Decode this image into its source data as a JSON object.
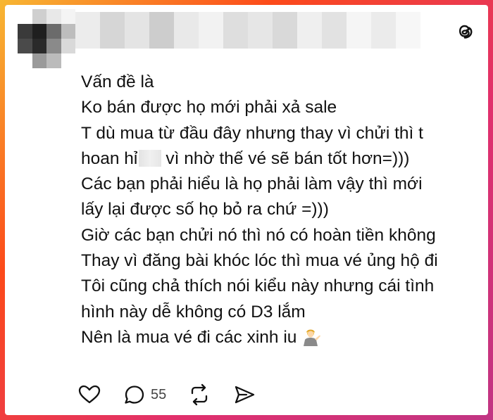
{
  "post": {
    "lines": [
      "Vấn đề là",
      "Ko bán được họ mới phải xả sale",
      "T dù mua từ đầu đây nhưng thay vì chửi thì t",
      "hoan hỉ",
      "vì nhờ thế vé sẽ bán tốt hơn=)))",
      "Các bạn phải hiểu là họ phải làm vậy thì mới",
      "lấy lại được số họ bỏ ra chứ =)))",
      "Giờ các bạn chửi nó thì nó có hoàn tiền không",
      "Thay vì đăng bài khóc lóc thì mua vé ủng hộ đi",
      "Tôi cũng chả thích nói kiểu này nhưng cái tình",
      "hình này dễ không có D3 lắm",
      "Nên là mua vé đi các xinh iu"
    ],
    "emoji_icon": "person-tipping-hand-emoji"
  },
  "actions": {
    "like_icon": "heart-icon",
    "reply_icon": "comment-icon",
    "reply_count": "55",
    "repost_icon": "repost-icon",
    "share_icon": "send-icon"
  },
  "brand": {
    "logo_icon": "threads-logo-icon"
  }
}
